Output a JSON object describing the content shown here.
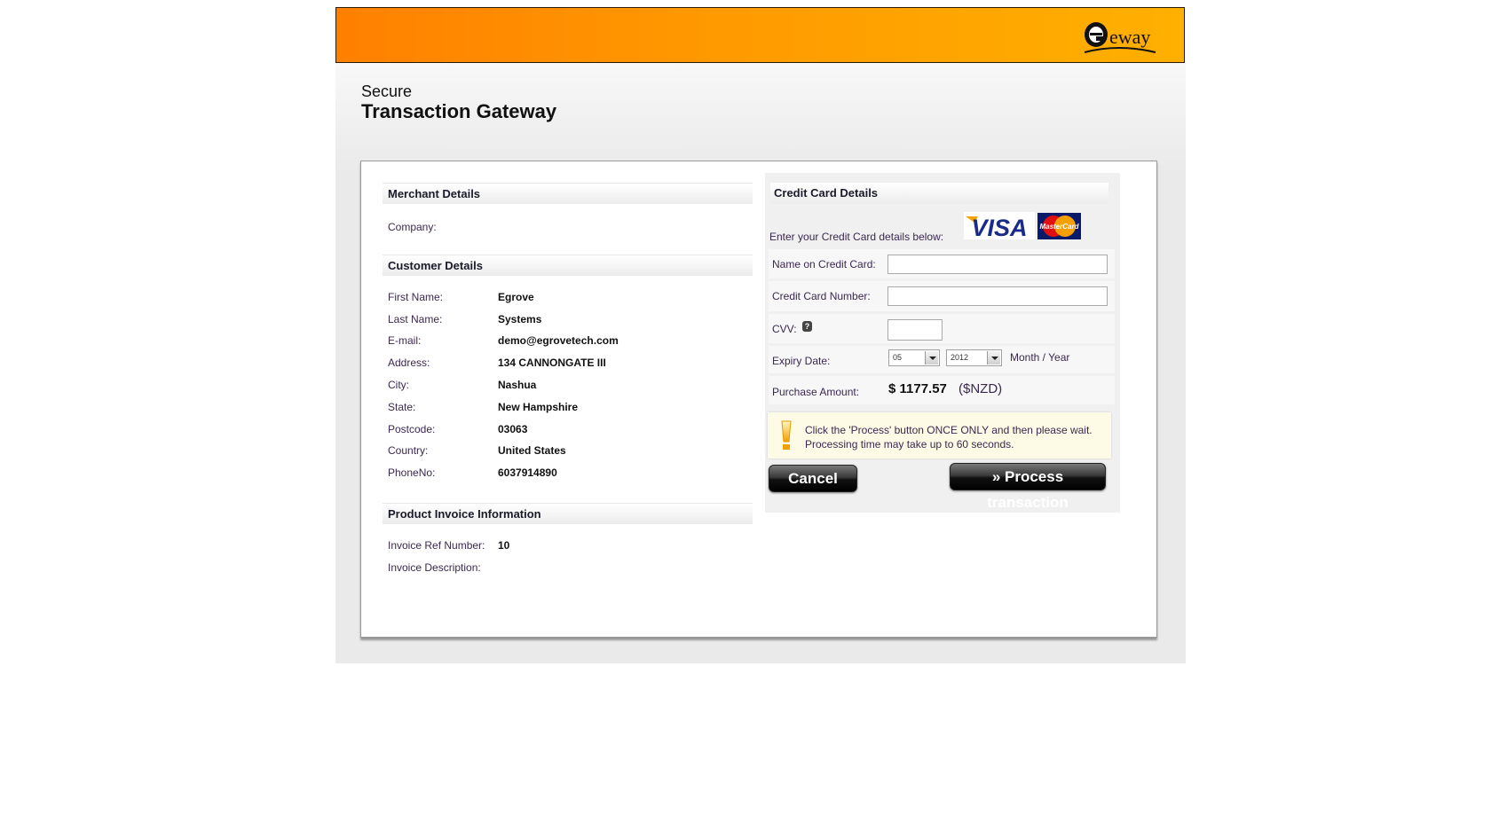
{
  "header": {
    "logo_text": "eway",
    "title_line1": "Secure",
    "title_line2": "Transaction Gateway"
  },
  "merchant": {
    "heading": "Merchant Details",
    "fields": [
      {
        "label": "Company:",
        "value": ""
      }
    ]
  },
  "customer": {
    "heading": "Customer Details",
    "fields": [
      {
        "label": "First Name:",
        "value": "Egrove"
      },
      {
        "label": "Last Name:",
        "value": "Systems"
      },
      {
        "label": "E-mail:",
        "value": "demo@egrovetech.com"
      },
      {
        "label": "Address:",
        "value": "134 CANNONGATE III"
      },
      {
        "label": "City:",
        "value": "Nashua"
      },
      {
        "label": "State:",
        "value": "New Hampshire"
      },
      {
        "label": "Postcode:",
        "value": "03063"
      },
      {
        "label": "Country:",
        "value": "United States"
      },
      {
        "label": "PhoneNo:",
        "value": "6037914890"
      }
    ]
  },
  "invoice": {
    "heading": "Product Invoice Information",
    "fields": [
      {
        "label": "Invoice Ref Number:",
        "value": "10"
      },
      {
        "label": "Invoice Description:",
        "value": ""
      }
    ]
  },
  "credit_card": {
    "heading": "Credit Card Details",
    "intro": "Enter your Credit Card details below:",
    "card_logos": [
      "VISA",
      "MasterCard"
    ],
    "name_label": "Name on Credit Card:",
    "name_value": "",
    "number_label": "Credit Card Number:",
    "number_value": "",
    "cvv_label": "CVV:",
    "cvv_help_icon": "?",
    "cvv_value": "",
    "expiry_label": "Expiry Date:",
    "expiry_month": "05",
    "expiry_year": "2012",
    "expiry_hint": "Month / Year",
    "amount_label": "Purchase Amount:",
    "amount_value": "$ 1177.57",
    "amount_currency": "($NZD)"
  },
  "notice": {
    "line1": "Click the 'Process' button ONCE ONLY and then please wait.",
    "line2": "Processing time may take up to 60 seconds."
  },
  "buttons": {
    "cancel": "Cancel",
    "process": "» Process transaction"
  },
  "colors": {
    "header_start": "#ff8000",
    "header_end": "#ffb000",
    "notice_bg": "#fdfbe6"
  }
}
